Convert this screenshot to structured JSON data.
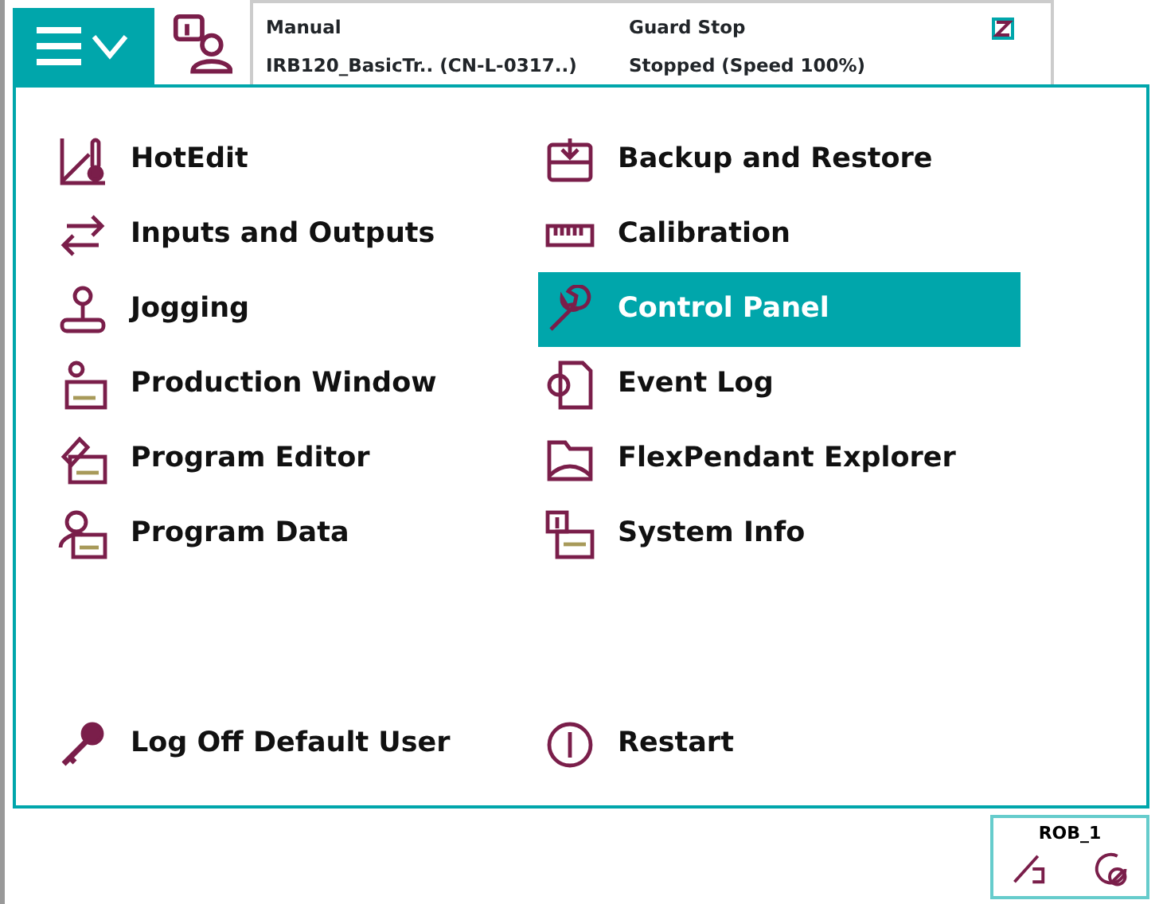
{
  "status": {
    "mode": "Manual",
    "system": "IRB120_BasicTr.. (CN-L-0317..)",
    "state": "Guard Stop",
    "speed": "Stopped (Speed 100%)"
  },
  "menu": {
    "left": [
      {
        "label": "HotEdit",
        "selected": false
      },
      {
        "label": "Inputs and Outputs",
        "selected": false
      },
      {
        "label": "Jogging",
        "selected": false
      },
      {
        "label": "Production Window",
        "selected": false
      },
      {
        "label": "Program Editor",
        "selected": false
      },
      {
        "label": "Program Data",
        "selected": false
      }
    ],
    "right": [
      {
        "label": "Backup and Restore",
        "selected": false
      },
      {
        "label": "Calibration",
        "selected": false
      },
      {
        "label": "Control Panel",
        "selected": true
      },
      {
        "label": "Event Log",
        "selected": false
      },
      {
        "label": "FlexPendant Explorer",
        "selected": false
      },
      {
        "label": "System Info",
        "selected": false
      }
    ],
    "bottom": [
      {
        "label": "Log Off Default User"
      },
      {
        "label": "Restart"
      }
    ]
  },
  "quickset": {
    "label": "ROB_1"
  }
}
